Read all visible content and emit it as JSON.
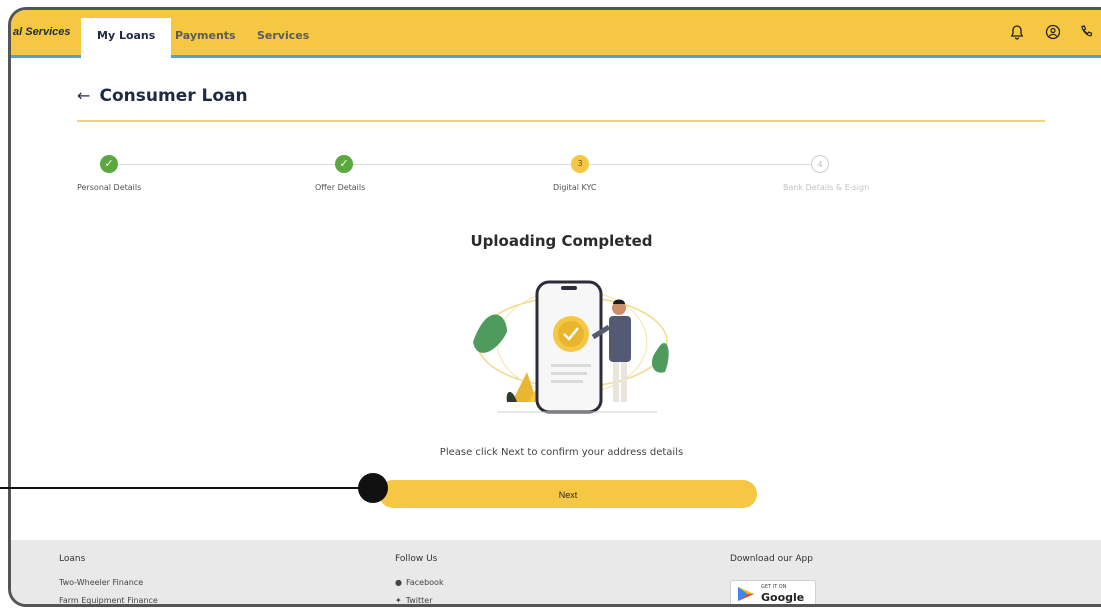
{
  "nav": {
    "brand": "al Services",
    "tabs": [
      {
        "label": "My Loans"
      },
      {
        "label": "Payments"
      },
      {
        "label": "Services"
      }
    ]
  },
  "page": {
    "title": "Consumer Loan"
  },
  "stepper": {
    "steps": [
      {
        "label": "Personal Details",
        "state": "done"
      },
      {
        "label": "Offer Details",
        "state": "done"
      },
      {
        "label": "Digital KYC",
        "state": "current",
        "number": "3"
      },
      {
        "label": "Bank Details & E-sign",
        "state": "future",
        "number": "4"
      }
    ]
  },
  "main": {
    "headline": "Uploading Completed",
    "confirm_text": "Please click Next to confirm your address details",
    "next_label": "Next"
  },
  "footer": {
    "loans": {
      "heading": "Loans",
      "links": [
        "Two-Wheeler Finance",
        "Farm Equipment Finance"
      ]
    },
    "follow": {
      "heading": "Follow Us",
      "links": [
        "Facebook",
        "Twitter"
      ]
    },
    "app": {
      "heading": "Download our App",
      "badge_small": "GET IT ON",
      "badge_big": "Google Play"
    }
  },
  "colors": {
    "brand_yellow": "#f6c743",
    "success_green": "#5aa83e",
    "nav_border_blue": "#4aa3d8"
  }
}
